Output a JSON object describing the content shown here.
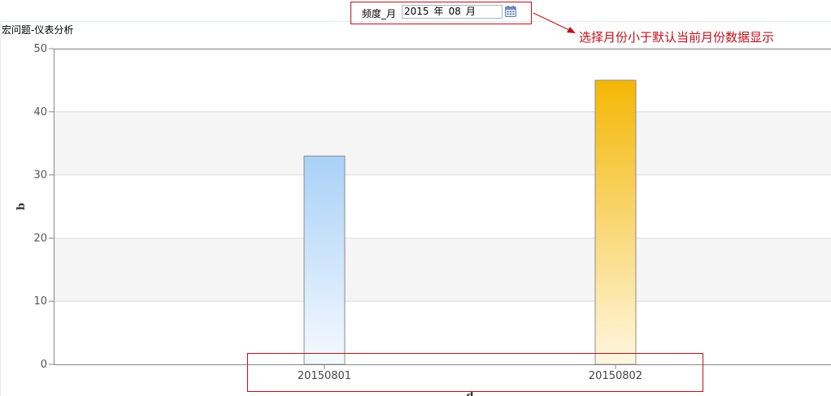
{
  "page": {
    "title": "宏问题-仪表分析"
  },
  "filter": {
    "label": "频度_月",
    "year": "2015",
    "year_unit": "年",
    "month": "08",
    "month_unit": "月"
  },
  "annotation": {
    "text": "选择月份小于默认当前月份数据显示"
  },
  "colors": {
    "annotation": "#c0101c",
    "bar_blue_top": "#a9d1f7",
    "bar_blue_bottom": "#f4f9ff",
    "bar_gold_top": "#f4b705",
    "bar_gold_bottom": "#fff7e0"
  },
  "chart_data": {
    "type": "bar",
    "categories": [
      "20150801",
      "20150802"
    ],
    "values": [
      33,
      45
    ],
    "title": "",
    "xlabel": "d",
    "ylabel": "b",
    "ylim": [
      0,
      50
    ],
    "yticks": [
      0,
      10,
      20,
      30,
      40,
      50
    ],
    "grid": true
  }
}
